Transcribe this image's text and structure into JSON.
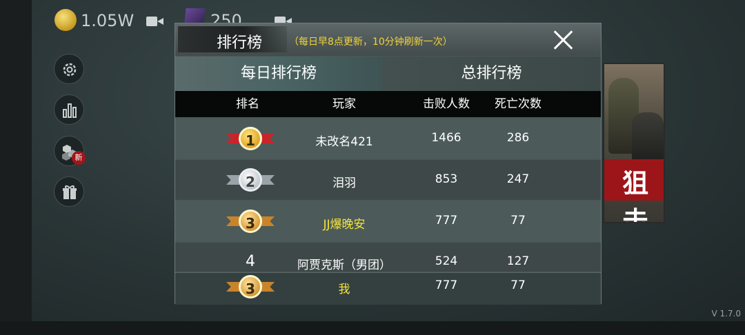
{
  "hud": {
    "coins": "1.05W",
    "gems": "250",
    "new_badge": "新",
    "version": "V 1.7.0"
  },
  "poster": {
    "text": "狙击"
  },
  "leaderboard": {
    "title": "排行榜",
    "subtitle": "（每日早8点更新，10分钟刷新一次）",
    "tabs": [
      "每日排行榜",
      "总排行榜"
    ],
    "active_tab": "每日排行榜",
    "columns": [
      "排名",
      "玩家",
      "击败人数",
      "死亡次数"
    ],
    "rows": [
      {
        "rank": "1",
        "medal": "gold",
        "player": "未改名421",
        "kills": "1466",
        "deaths": "286"
      },
      {
        "rank": "2",
        "medal": "silver",
        "player": "泪羽",
        "kills": "853",
        "deaths": "247"
      },
      {
        "rank": "3",
        "medal": "bronze",
        "player": "JJ爆晚安",
        "kills": "777",
        "deaths": "77"
      },
      {
        "rank": "4",
        "medal": "",
        "player": "阿贾克斯（男团）",
        "kills": "524",
        "deaths": "127"
      }
    ],
    "me": {
      "rank": "3",
      "medal": "bronze",
      "player": "我",
      "kills": "777",
      "deaths": "77"
    }
  },
  "colors": {
    "highlight_yellow": "#f2e43c",
    "subtitle_yellow": "#f0d43a",
    "header_black": "#070808"
  }
}
